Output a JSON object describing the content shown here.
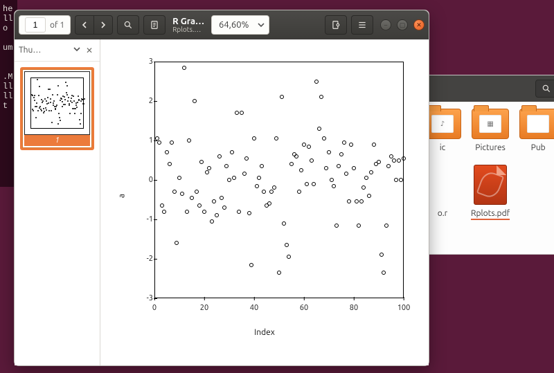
{
  "header": {
    "page_value": "1",
    "page_of_label": "of 1",
    "title": "R Gra…",
    "subtitle": "Rplots.…",
    "zoom_text": "64,60%"
  },
  "sidebar": {
    "title": "Thu…",
    "thumb_label": "1"
  },
  "files": {
    "music_label": "ic",
    "pictures_label": "Pictures",
    "pub_label": "Pub",
    "r_label": "o.r",
    "pdf_label": "Rplots.pdf"
  },
  "terminal": "he\nll\no\n\num\n\n  \n.M\nll\nll\nt",
  "chart_data": {
    "type": "scatter",
    "title": "",
    "xlabel": "Index",
    "ylabel": "a",
    "xlim": [
      0,
      100
    ],
    "ylim": [
      -3,
      3
    ],
    "xticks": [
      0,
      20,
      40,
      60,
      80,
      100
    ],
    "yticks": [
      -3,
      -2,
      -1,
      0,
      1,
      2,
      3
    ],
    "series": [
      {
        "name": "a",
        "x": [
          1,
          2,
          3,
          4,
          5,
          6,
          7,
          8,
          9,
          10,
          11,
          12,
          13,
          14,
          15,
          16,
          17,
          18,
          19,
          20,
          21,
          22,
          23,
          24,
          25,
          26,
          27,
          28,
          29,
          30,
          31,
          32,
          33,
          34,
          35,
          36,
          37,
          38,
          39,
          40,
          41,
          42,
          43,
          44,
          45,
          46,
          47,
          48,
          49,
          50,
          51,
          52,
          53,
          54,
          55,
          56,
          57,
          58,
          59,
          60,
          61,
          62,
          63,
          64,
          65,
          66,
          67,
          68,
          69,
          70,
          71,
          72,
          73,
          74,
          75,
          76,
          77,
          78,
          79,
          80,
          81,
          82,
          83,
          84,
          85,
          86,
          87,
          88,
          89,
          90,
          91,
          92,
          93,
          94,
          95,
          96,
          97,
          98,
          99,
          100
        ],
        "y": [
          1.05,
          0.95,
          -0.65,
          -0.8,
          0.7,
          0.4,
          0.95,
          -0.3,
          -1.6,
          0.05,
          -0.35,
          2.85,
          -0.8,
          1.0,
          -0.45,
          2.0,
          -0.3,
          -0.65,
          0.45,
          -0.8,
          0.2,
          0.3,
          -1.05,
          -0.55,
          -0.9,
          0.6,
          -0.45,
          -0.7,
          0.35,
          0.0,
          0.7,
          0.05,
          1.7,
          -0.8,
          1.7,
          0.15,
          0.55,
          -0.85,
          -2.15,
          1.05,
          -0.15,
          0.05,
          0.35,
          -0.3,
          -0.65,
          -0.6,
          -0.3,
          -0.2,
          1.05,
          -2.35,
          2.1,
          -1.1,
          -1.65,
          -1.95,
          0.4,
          0.65,
          0.6,
          -0.3,
          0.25,
          0.9,
          -0.1,
          0.85,
          0.5,
          -0.1,
          2.5,
          1.3,
          2.1,
          1.05,
          0.3,
          0.7,
          0.0,
          -0.15,
          -1.15,
          0.35,
          0.65,
          0.95,
          0.15,
          -0.55,
          0.9,
          0.3,
          -0.55,
          -1.15,
          -0.55,
          -0.2,
          0.05,
          -0.4,
          0.2,
          0.9,
          0.4,
          0.45,
          -1.9,
          -2.35,
          -1.15,
          0.35,
          0.6,
          0.5,
          0.0,
          0.5,
          0.0,
          0.55
        ]
      }
    ]
  }
}
